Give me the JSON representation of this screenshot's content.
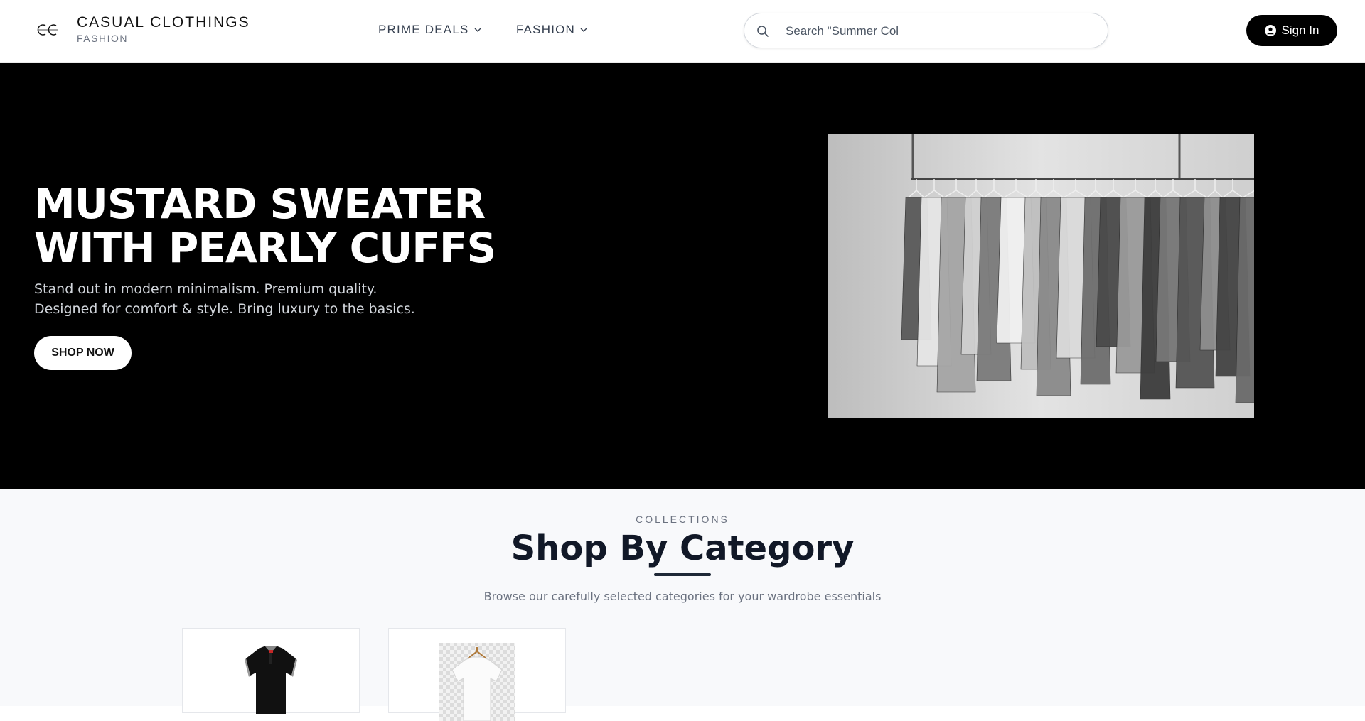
{
  "header": {
    "logo_icon": "cc-monogram-icon",
    "brand_name": "CASUAL CLOTHINGS",
    "brand_sub": "FASHION",
    "nav": [
      {
        "label": "PRIME DEALS",
        "icon": "chevron-down-icon"
      },
      {
        "label": "FASHION",
        "icon": "chevron-down-icon"
      }
    ],
    "search": {
      "placeholder": "Search \"Summer Col",
      "icon": "search-icon"
    },
    "signin": {
      "label": "Sign In",
      "icon": "user-icon"
    }
  },
  "hero": {
    "title": "MUSTARD SWEATER WITH PEARLY CUFFS",
    "subtitle": "Stand out in modern minimalism. Premium quality. Designed for comfort & style. Bring luxury to the basics.",
    "cta": "SHOP NOW",
    "image": "clothing-rack-photo"
  },
  "categories": {
    "kicker": "COLLECTIONS",
    "title": "Shop By Category",
    "description": "Browse our carefully selected categories for your wardrobe essentials",
    "items": [
      {
        "image": "black-polo-shirt"
      },
      {
        "image": "white-tshirt-on-hanger"
      }
    ]
  },
  "colors": {
    "accent": "#000000",
    "hero_bg": "#000000",
    "section_bg": "#f8f9fb",
    "title": "#111827",
    "muted": "#6b7280"
  }
}
